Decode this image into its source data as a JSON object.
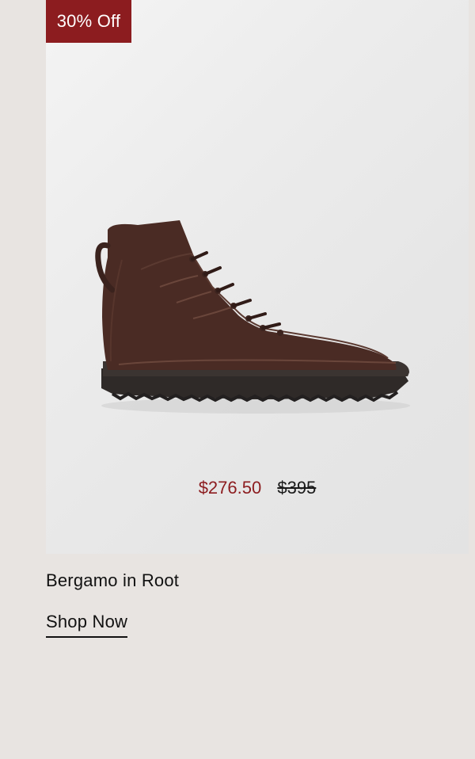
{
  "product": {
    "badge": "30% Off",
    "sale_price": "$276.50",
    "original_price": "$395",
    "title": "Bergamo in Root",
    "cta_label": "Shop Now",
    "image_description": "suede-lace-up-boot"
  },
  "colors": {
    "page_background": "#e8e4e1",
    "badge_background": "#8c1c1f",
    "sale_price": "#8c1c1f",
    "boot_upper": "#4a2b24",
    "boot_sole": "#2f2a28"
  }
}
